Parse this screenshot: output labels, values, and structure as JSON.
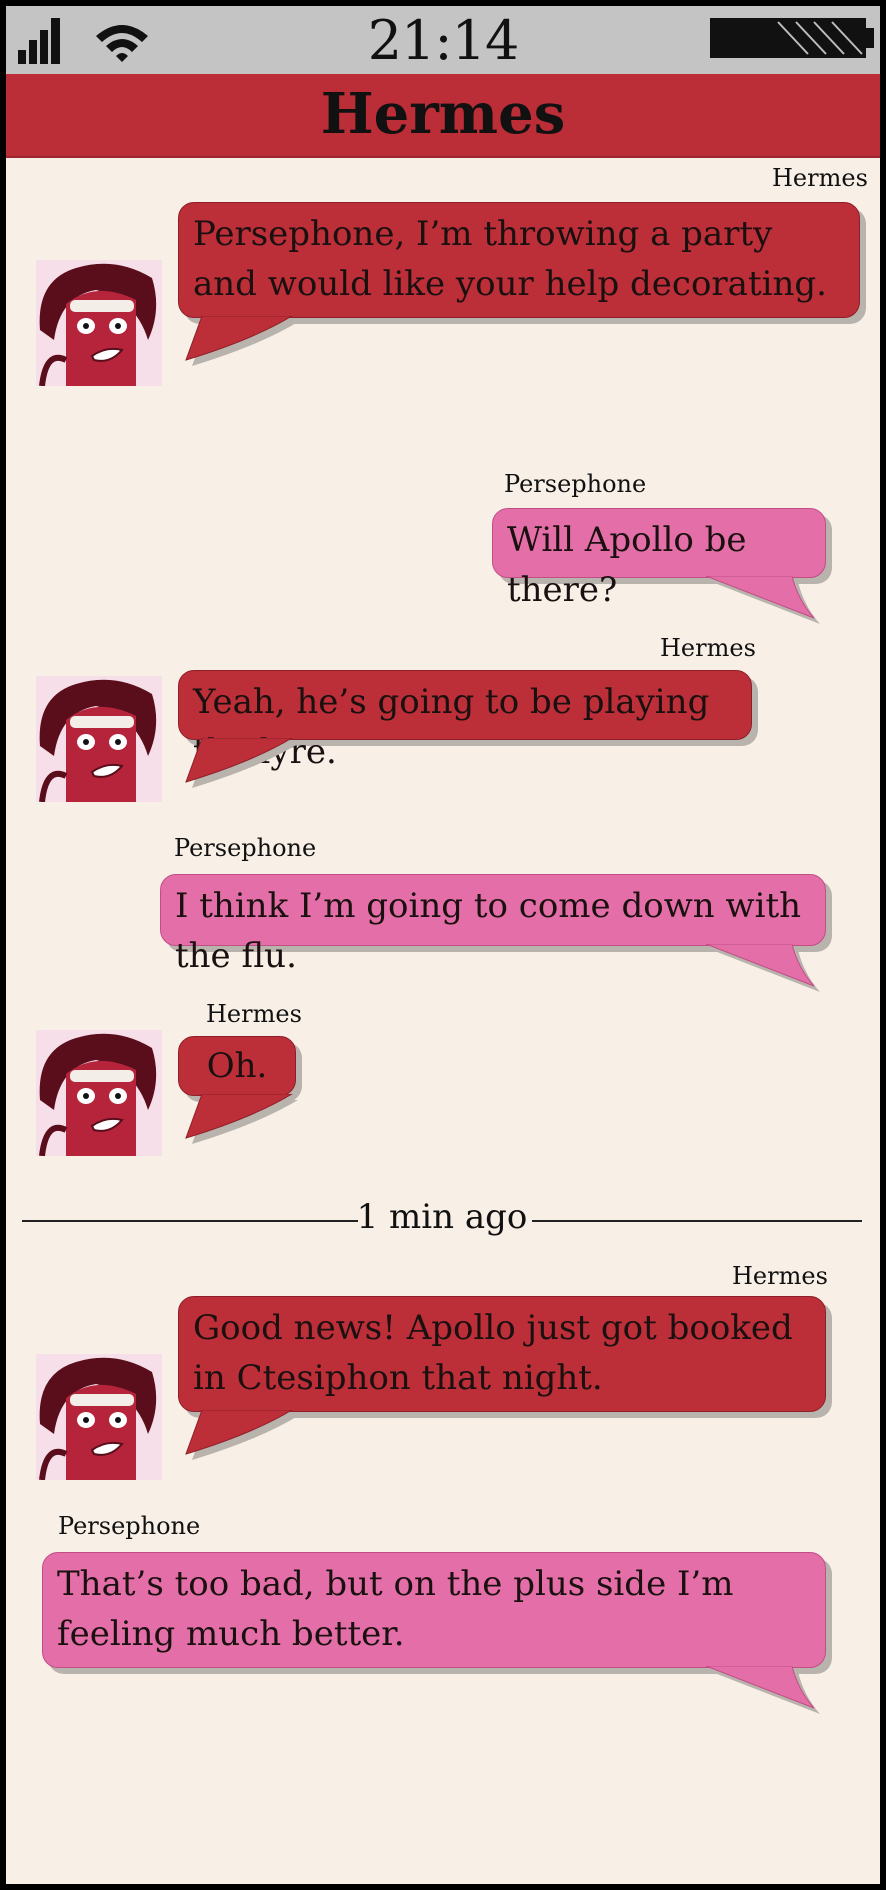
{
  "status_bar": {
    "time": "21:14"
  },
  "header": {
    "title": "Hermes"
  },
  "messages": [
    {
      "sender": "Hermes",
      "text": "Persephone, I’m throwing a party and would like your help decorating."
    },
    {
      "sender": "Persephone",
      "text": "Will Apollo be there?"
    },
    {
      "sender": "Hermes",
      "text": "Yeah, he’s going to be playing the lyre."
    },
    {
      "sender": "Persephone",
      "text": "I think I’m going to come down with the flu."
    },
    {
      "sender": "Hermes",
      "text": "Oh."
    },
    {
      "sender": "Hermes",
      "text": "Good news! Apollo just got booked in Ctesiphon that night."
    },
    {
      "sender": "Persephone",
      "text": "That’s too bad, but on the plus side I’m feeling much better."
    }
  ],
  "divider": {
    "label": "1 min ago"
  },
  "colors": {
    "hermes_bubble": "#bc2e38",
    "persephone_bubble": "#e46fa8",
    "header": "#bb2d37",
    "background": "#f8efe6",
    "status_bar": "#c4c4c4"
  }
}
